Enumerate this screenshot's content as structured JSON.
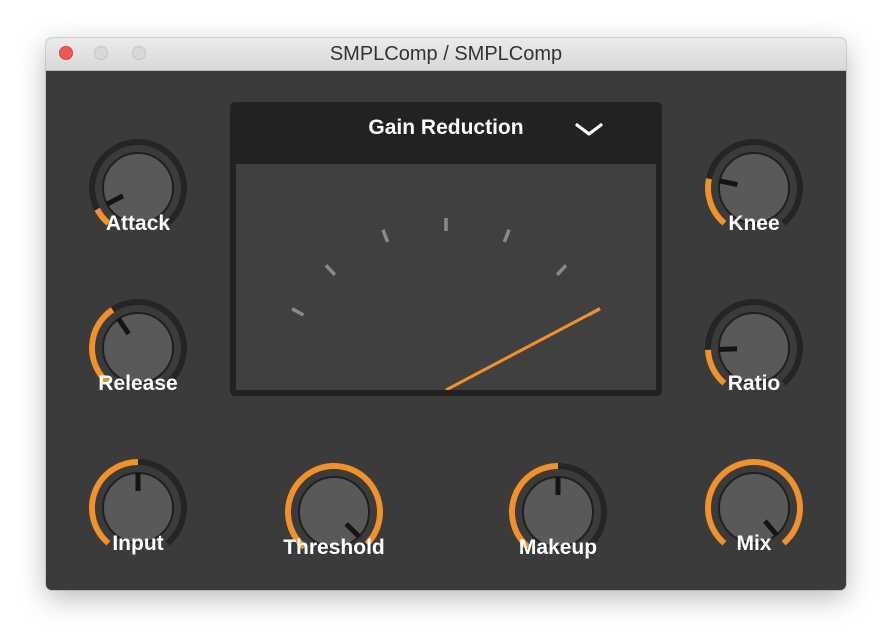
{
  "window": {
    "title": "SMPLComp / SMPLComp"
  },
  "colors": {
    "accent": "#f0912c",
    "panel": "#3b3b3b",
    "knob_face": "#595959",
    "track": "#252525"
  },
  "meter": {
    "mode": "Gain Reduction",
    "level": 0.0
  },
  "knobs": [
    {
      "id": "attack",
      "label": "Attack",
      "value": 0.08
    },
    {
      "id": "release",
      "label": "Release",
      "value": 0.38
    },
    {
      "id": "input",
      "label": "Input",
      "value": 0.5
    },
    {
      "id": "threshold",
      "label": "Threshold",
      "value": 0.98
    },
    {
      "id": "makeup",
      "label": "Makeup",
      "value": 0.5
    },
    {
      "id": "knee",
      "label": "Knee",
      "value": 0.22
    },
    {
      "id": "ratio",
      "label": "Ratio",
      "value": 0.17
    },
    {
      "id": "mix",
      "label": "Mix",
      "value": 1.0
    }
  ]
}
